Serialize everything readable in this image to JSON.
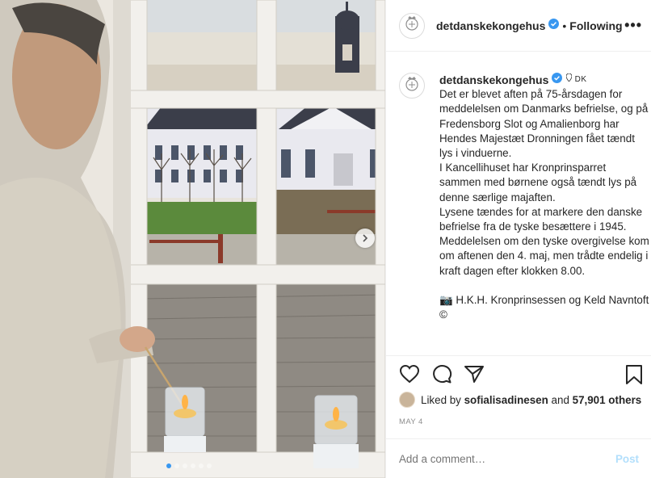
{
  "post": {
    "username": "detdanskekongehus",
    "header_separator": "•",
    "follow_status": "Following",
    "more_label": "•••",
    "location": "DK",
    "caption": "Det er blevet aften på 75-årsdagen for meddelelsen om Danmarks befrielse, og på Fredensborg Slot og Amalienborg har Hendes Majestæt Dronningen fået tændt lys i vinduerne.\nI Kancellihuset har Kronprinsparret sammen med børnene også tændt lys på denne særlige majaften.\nLysene tændes for at markere den danske befrielse fra de tyske besættere i 1945. Meddelelsen om den tyske overgivelse kom om aftenen den 4. maj, men trådte endelig i kraft dagen efter klokken 8.00.\n\n📷 H.K.H. Kronprinsessen og Keld Navntoft ©",
    "liked_by_prefix": "Liked by",
    "liked_by_user": "sofialisadinesen",
    "liked_by_and": "and",
    "likes_count": "57,901 others",
    "date": "MAY 4",
    "comment_placeholder": "Add a comment…",
    "post_label": "Post"
  },
  "carousel": {
    "total": 6,
    "active_index": 0
  },
  "icons": {
    "verified": "verified-badge-icon",
    "like": "heart-icon",
    "comment": "comment-icon",
    "share": "paper-plane-icon",
    "save": "bookmark-icon",
    "next": "chevron-right-icon"
  },
  "colors": {
    "verified": "#3897f0",
    "post_disabled": "#b2dffc",
    "muted": "#8e8e8e",
    "border": "#efefef",
    "text": "#262626"
  }
}
